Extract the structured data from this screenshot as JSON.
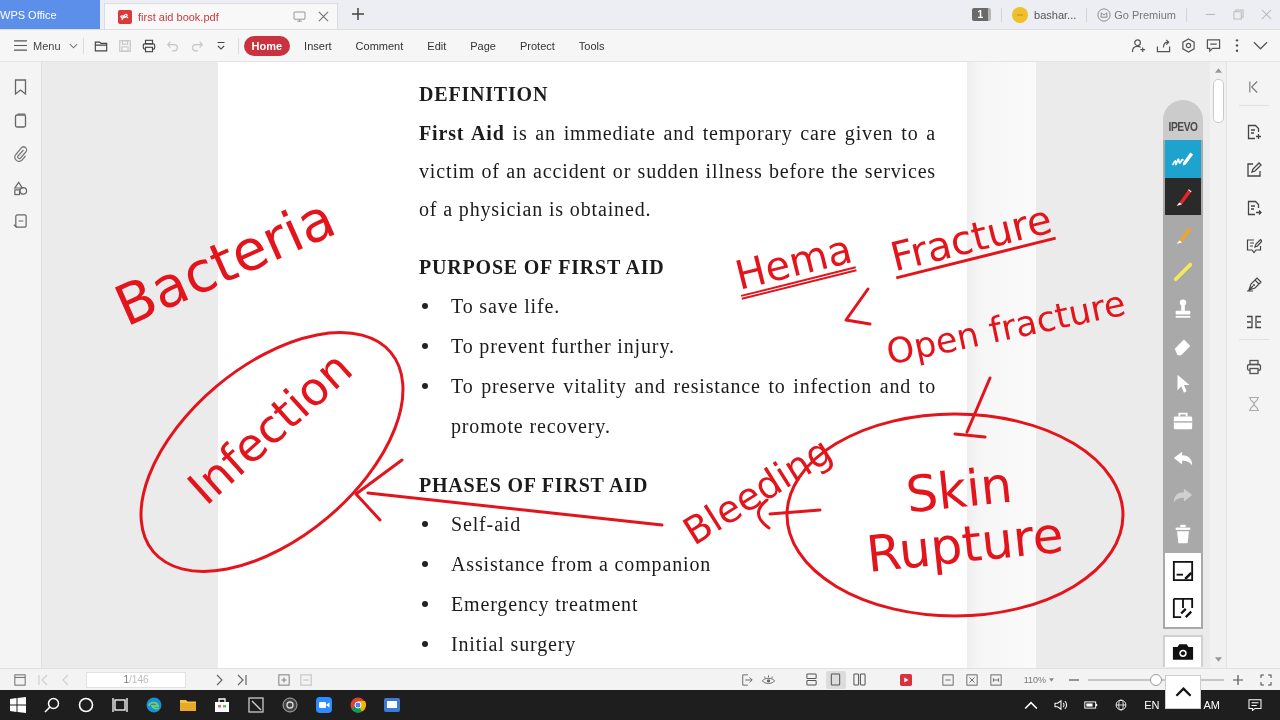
{
  "window": {
    "tabs": [
      {
        "label": "WPS Office",
        "kind": "home",
        "selected": false
      },
      {
        "label": "first aid book.pdf",
        "kind": "document",
        "selected": true
      }
    ],
    "window_count": "1",
    "account": "bashar...",
    "premium": "Go Premium"
  },
  "toolbar": {
    "menu": "Menu",
    "quick_tools": [
      {
        "kind": "open",
        "disabled": false
      },
      {
        "kind": "save",
        "disabled": true
      },
      {
        "kind": "print",
        "disabled": false
      },
      {
        "kind": "undo",
        "disabled": true
      },
      {
        "kind": "redo",
        "disabled": true
      },
      {
        "kind": "more",
        "disabled": false
      }
    ],
    "tabs": [
      {
        "label": "Home",
        "selected": true
      },
      {
        "label": "Insert",
        "selected": false
      },
      {
        "label": "Comment",
        "selected": false
      },
      {
        "label": "Edit",
        "selected": false
      },
      {
        "label": "Page",
        "selected": false
      },
      {
        "label": "Protect",
        "selected": false
      },
      {
        "label": "Tools",
        "selected": false
      }
    ]
  },
  "document": {
    "sections": [
      {
        "heading": "DEFINITION",
        "paragraph": "**First Aid** is an immediate and temporary care given to a victim of an accident or sudden illness before the services of a physician is obtained."
      },
      {
        "heading": "PURPOSE OF FIRST AID",
        "bullets": [
          "To save life.",
          "To prevent further injury.",
          "To preserve vitality and resistance to infection and to promote recovery."
        ]
      },
      {
        "heading": "PHASES OF FIRST AID",
        "bullets": [
          "Self-aid",
          "Assistance from a companion",
          "Emergency treatment",
          "Initial surgery"
        ]
      }
    ]
  },
  "ink_notes": [
    "Bacteria",
    "Infection",
    "Hema",
    "Fracture",
    "Open fracture",
    "Bleeding",
    "Skin Rupture"
  ],
  "ipevo": {
    "label": "IPEVO",
    "tools": [
      {
        "kind": "handwriting",
        "selected": false,
        "disabled": false
      },
      {
        "kind": "pen",
        "selected": true,
        "disabled": false
      },
      {
        "kind": "pencil",
        "selected": false,
        "disabled": false
      },
      {
        "kind": "highlighter",
        "selected": false,
        "disabled": false
      },
      {
        "kind": "stamp",
        "selected": false,
        "disabled": false
      },
      {
        "kind": "eraser",
        "selected": false,
        "disabled": false
      },
      {
        "kind": "pointer",
        "selected": false,
        "disabled": false
      },
      {
        "kind": "toolbox",
        "selected": false,
        "disabled": false
      },
      {
        "kind": "undo",
        "selected": false,
        "disabled": false
      },
      {
        "kind": "redo",
        "selected": false,
        "disabled": true
      },
      {
        "kind": "trash",
        "selected": false,
        "disabled": false
      }
    ]
  },
  "status_bar": {
    "nav": [
      {
        "kind": "first",
        "disabled": true
      },
      {
        "kind": "prev",
        "disabled": true
      },
      {
        "kind": "next",
        "disabled": false
      },
      {
        "kind": "last",
        "disabled": false
      }
    ],
    "page": "1",
    "page_total": "/146",
    "view_modes": [
      {
        "kind": "continuous",
        "selected": false
      },
      {
        "kind": "single",
        "selected": true
      },
      {
        "kind": "two-page",
        "selected": false
      }
    ],
    "zoom": "110%",
    "zoom_slider": {
      "level": 0.5
    }
  },
  "taskbar": {
    "language": "EN",
    "clock": "AM"
  }
}
